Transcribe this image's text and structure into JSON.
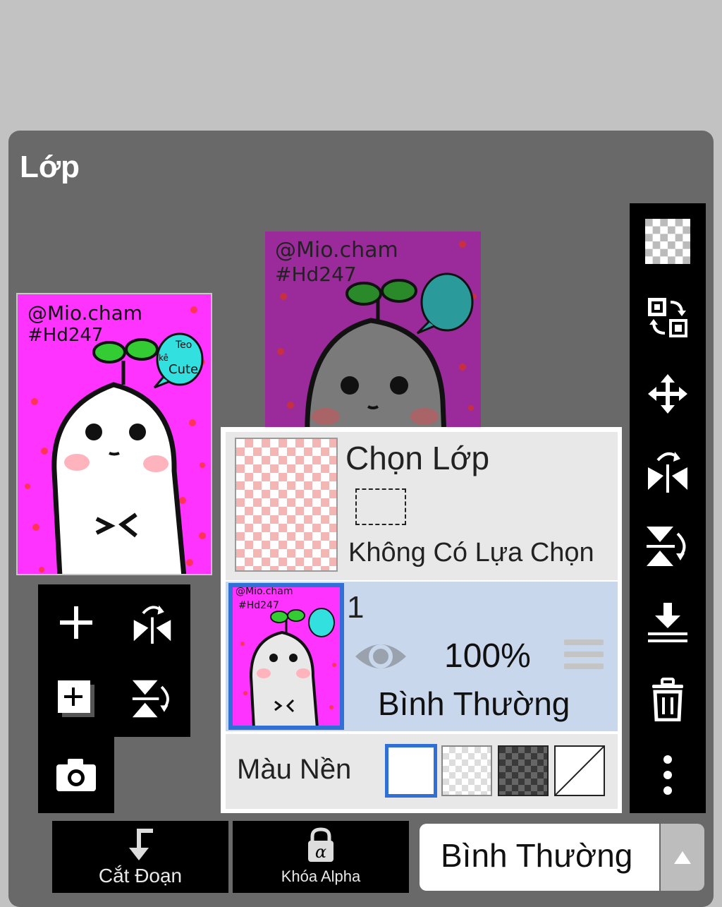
{
  "dialog": {
    "title": "Lớp"
  },
  "artwork": {
    "watermark": "@Mio.cham",
    "tag": "#Hd247",
    "bubble_top": "Teo",
    "bubble_mid": "kê",
    "bubble_bottom": "Cute",
    "bg_main": "#ff33ff",
    "bg_dim": "#9b2b9b"
  },
  "right_tools": [
    {
      "name": "transparency-icon"
    },
    {
      "name": "swap-layers-icon"
    },
    {
      "name": "move-icon"
    },
    {
      "name": "flip-horizontal-icon"
    },
    {
      "name": "flip-vertical-icon"
    },
    {
      "name": "merge-down-icon"
    },
    {
      "name": "trash-icon"
    },
    {
      "name": "more-vertical-icon"
    }
  ],
  "left_tools": [
    {
      "name": "add-layer-icon"
    },
    {
      "name": "flip-horizontal-icon"
    },
    {
      "name": "duplicate-layer-icon"
    },
    {
      "name": "flip-vertical-icon"
    },
    {
      "name": "camera-icon"
    }
  ],
  "selection_layer": {
    "title": "Chọn Lớp",
    "status": "Không Có Lựa Chọn"
  },
  "layer": {
    "number": "1",
    "opacity": "100%",
    "blend": "Bình Thường",
    "visible": true
  },
  "background": {
    "label": "Màu Nền",
    "options": [
      "white",
      "light-checker",
      "dark-checker",
      "none"
    ],
    "selected": "white",
    "accent": "#2f6fd6"
  },
  "bottom": {
    "cut_label": "Cắt Đoạn",
    "alpha_label": "Khóa Alpha",
    "blend_value": "Bình Thường"
  }
}
